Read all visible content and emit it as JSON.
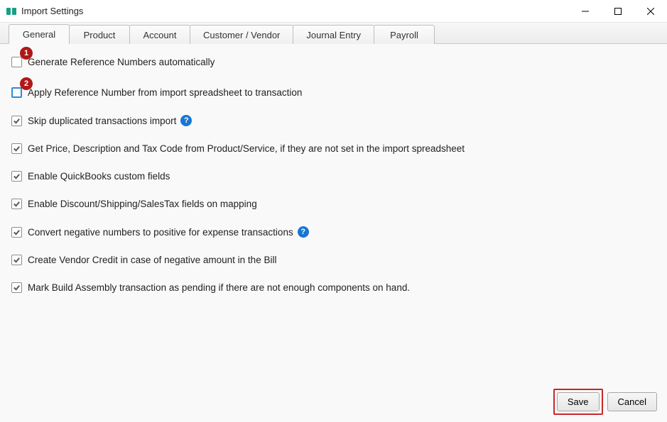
{
  "window": {
    "title": "Import Settings"
  },
  "tabs": [
    {
      "label": "General",
      "active": true
    },
    {
      "label": "Product",
      "active": false
    },
    {
      "label": "Account",
      "active": false
    },
    {
      "label": "Customer / Vendor",
      "active": false
    },
    {
      "label": "Journal Entry",
      "active": false
    },
    {
      "label": "Payroll",
      "active": false
    }
  ],
  "badges": {
    "b1": "1",
    "b2": "2"
  },
  "options": {
    "generate_ref": {
      "label": "Generate Reference Numbers automatically",
      "checked": false,
      "help": false
    },
    "apply_ref": {
      "label": "Apply Reference Number from import spreadsheet to transaction",
      "checked": false,
      "help": false
    },
    "skip_dup": {
      "label": "Skip duplicated transactions import",
      "checked": true,
      "help": true
    },
    "get_price": {
      "label": "Get Price, Description and Tax Code from Product/Service, if they are not set in the import spreadsheet",
      "checked": true,
      "help": false
    },
    "enable_custom": {
      "label": "Enable QuickBooks custom fields",
      "checked": true,
      "help": false
    },
    "enable_discount": {
      "label": "Enable Discount/Shipping/SalesTax fields on mapping",
      "checked": true,
      "help": false
    },
    "convert_neg": {
      "label": "Convert negative numbers to positive for expense transactions",
      "checked": true,
      "help": true
    },
    "vendor_credit": {
      "label": "Create Vendor Credit in case of negative amount in the Bill",
      "checked": true,
      "help": false
    },
    "mark_build": {
      "label": "Mark Build Assembly transaction as pending if there are not enough components on hand.",
      "checked": true,
      "help": false
    }
  },
  "buttons": {
    "save": "Save",
    "cancel": "Cancel"
  }
}
